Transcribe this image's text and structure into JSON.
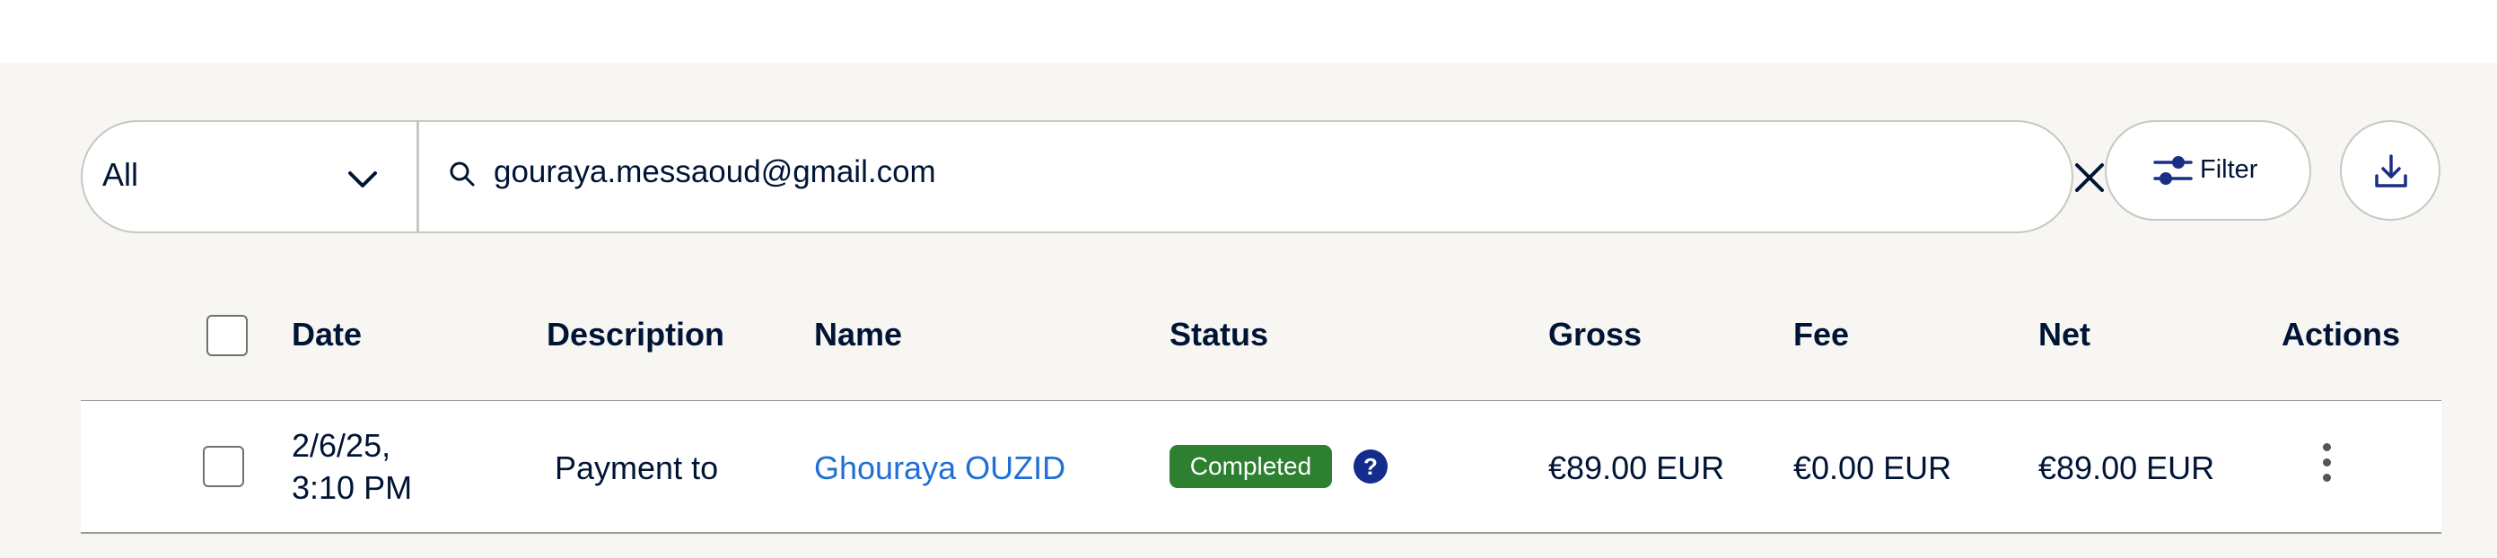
{
  "toolbar": {
    "type_select": {
      "value": "All"
    },
    "search": {
      "value": "gouraya.messaoud@gmail.com"
    },
    "filter_label": "Filter"
  },
  "table": {
    "headers": {
      "date": "Date",
      "description": "Description",
      "name": "Name",
      "status": "Status",
      "gross": "Gross",
      "fee": "Fee",
      "net": "Net",
      "actions": "Actions"
    },
    "rows": [
      {
        "date_line1": "2/6/25,",
        "date_line2": "3:10 PM",
        "description": "Payment to",
        "name": "Ghouraya OUZID",
        "status": "Completed",
        "gross": "€89.00 EUR",
        "fee": "€0.00 EUR",
        "net": "€89.00 EUR"
      }
    ]
  },
  "icons": {
    "chevron": "chevron-down-icon",
    "search": "search-icon",
    "clear": "close-icon",
    "filter": "sliders-icon",
    "download": "download-icon",
    "help": "help-icon",
    "actions": "kebab-menu-icon"
  },
  "colors": {
    "band": "#f7f6f3",
    "text": "#001435",
    "link": "#1f6fd6",
    "status_completed": "#2e8031",
    "help_icon": "#142c8e"
  }
}
